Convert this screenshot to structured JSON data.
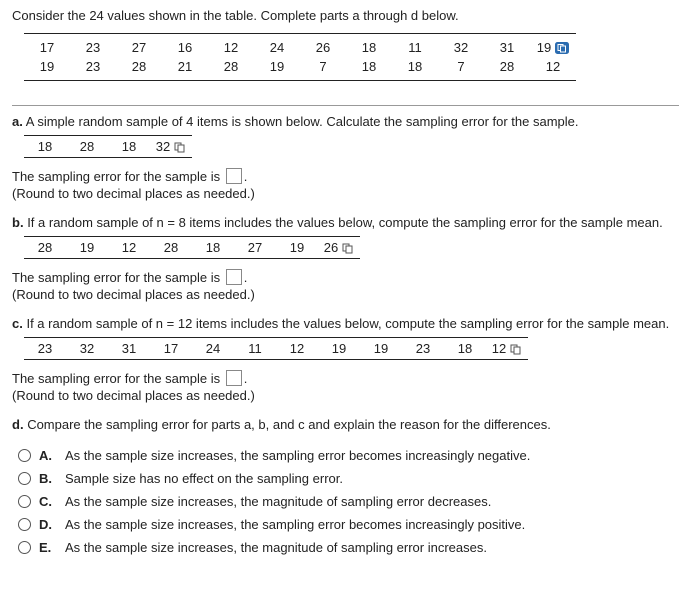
{
  "prompt": "Consider the 24 values shown in the table. Complete parts a through d below.",
  "population": {
    "rows": [
      [
        "17",
        "23",
        "27",
        "16",
        "12",
        "24",
        "26",
        "18",
        "11",
        "32",
        "31",
        "19"
      ],
      [
        "19",
        "23",
        "28",
        "21",
        "28",
        "19",
        "7",
        "18",
        "18",
        "7",
        "28",
        "12"
      ]
    ]
  },
  "parts": {
    "a": {
      "label": "a.",
      "text": "A simple random sample of 4 items is shown below. Calculate the sampling error for the sample.",
      "sample": [
        "18",
        "28",
        "18",
        "32"
      ],
      "answer_lead": "The sampling error for the sample is",
      "answer_tail": ".",
      "hint": "(Round to two decimal places as needed.)"
    },
    "b": {
      "label": "b.",
      "text": "If a random sample of n = 8 items includes the values below, compute the sampling error for the sample mean.",
      "sample": [
        "28",
        "19",
        "12",
        "28",
        "18",
        "27",
        "19",
        "26"
      ],
      "answer_lead": "The sampling error for the sample is",
      "answer_tail": ".",
      "hint": "(Round to two decimal places as needed.)"
    },
    "c": {
      "label": "c.",
      "text": "If a random sample of n = 12 items includes the values below, compute the sampling error for the sample mean.",
      "sample": [
        "23",
        "32",
        "31",
        "17",
        "24",
        "11",
        "12",
        "19",
        "19",
        "23",
        "18",
        "12"
      ],
      "answer_lead": "The sampling error for the sample is",
      "answer_tail": ".",
      "hint": "(Round to two decimal places as needed.)"
    },
    "d": {
      "label": "d.",
      "text": "Compare the sampling error for parts a, b, and c and explain the reason for the differences.",
      "choices": [
        {
          "letter": "A.",
          "text": "As the sample size increases, the sampling error becomes increasingly negative."
        },
        {
          "letter": "B.",
          "text": "Sample size has no effect on the sampling error."
        },
        {
          "letter": "C.",
          "text": "As the sample size increases, the magnitude of sampling error decreases."
        },
        {
          "letter": "D.",
          "text": "As the sample size increases, the sampling error becomes increasingly positive."
        },
        {
          "letter": "E.",
          "text": "As the sample size increases, the magnitude of sampling error increases."
        }
      ]
    }
  },
  "chart_data": {
    "type": "table",
    "title": "Population of 24 values",
    "rows": [
      [
        17,
        23,
        27,
        16,
        12,
        24,
        26,
        18,
        11,
        32,
        31,
        19
      ],
      [
        19,
        23,
        28,
        21,
        28,
        19,
        7,
        18,
        18,
        7,
        28,
        12
      ]
    ]
  }
}
